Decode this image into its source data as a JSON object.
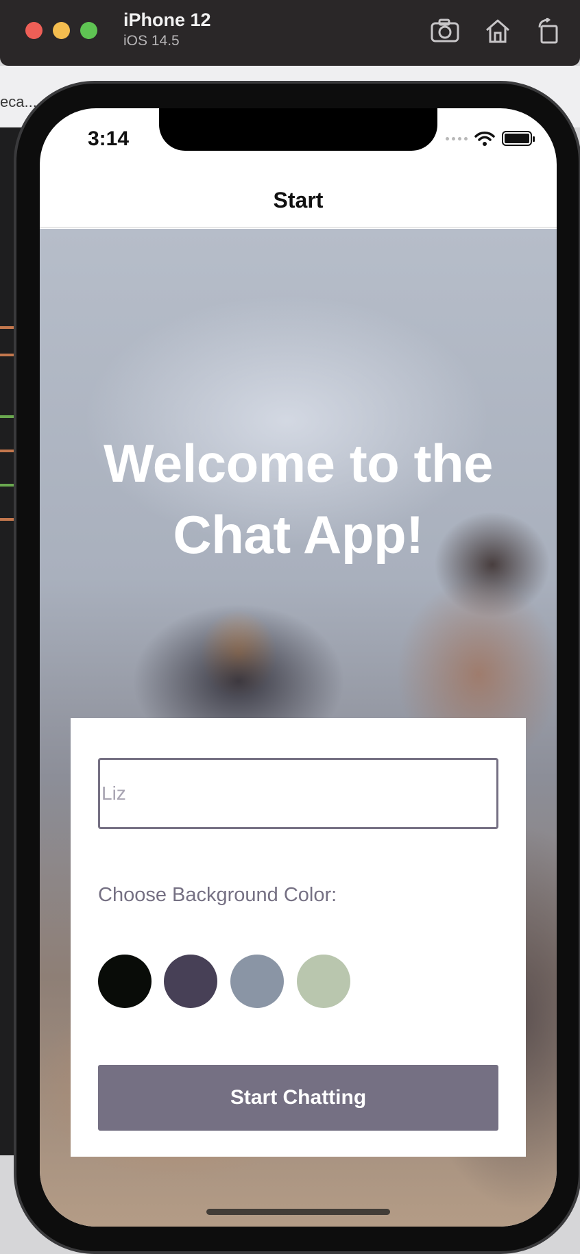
{
  "simulator": {
    "device_name": "iPhone 12",
    "os_version": "iOS 14.5",
    "tools": [
      "camera-icon",
      "home-icon",
      "rotate-icon"
    ]
  },
  "desktop": {
    "tab_text": "eca..."
  },
  "status_bar": {
    "time": "3:14"
  },
  "nav": {
    "title": "Start"
  },
  "hero": {
    "title_line1": "Welcome to the",
    "title_line2": "Chat App!"
  },
  "form": {
    "name_placeholder": "Liz",
    "color_label": "Choose Background Color:",
    "colors": [
      "#090C08",
      "#474056",
      "#8A95A5",
      "#B9C6AE"
    ],
    "button_label": "Start Chatting",
    "accent": "#757083"
  }
}
